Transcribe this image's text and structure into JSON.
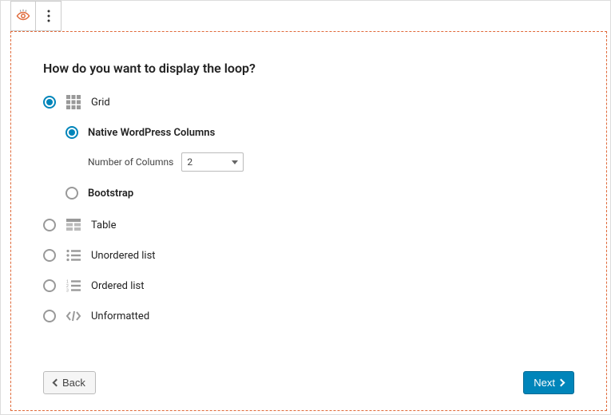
{
  "title": "How do you want to display the loop?",
  "options": {
    "grid": {
      "label": "Grid",
      "selected": true
    },
    "table": {
      "label": "Table",
      "selected": false
    },
    "ul": {
      "label": "Unordered list",
      "selected": false
    },
    "ol": {
      "label": "Ordered list",
      "selected": false
    },
    "unformatted": {
      "label": "Unformatted",
      "selected": false
    }
  },
  "grid_sub": {
    "native": {
      "label": "Native WordPress Columns",
      "selected": true
    },
    "bootstrap": {
      "label": "Bootstrap",
      "selected": false
    },
    "columns_label": "Number of Columns",
    "columns_value": "2"
  },
  "buttons": {
    "back": "Back",
    "next": "Next"
  }
}
